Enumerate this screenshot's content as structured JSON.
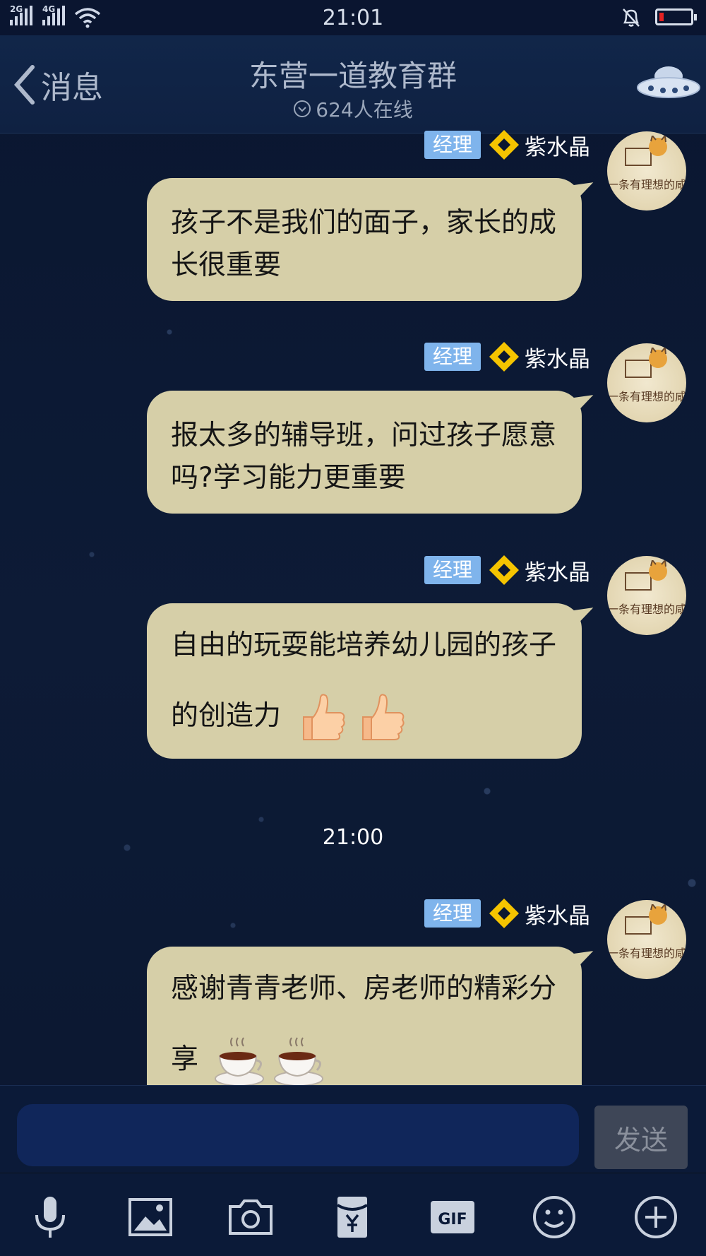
{
  "status_bar": {
    "signal1_label": "2G",
    "signal2_label": "4G",
    "time": "21:01"
  },
  "header": {
    "back_label": "消息",
    "title": "东营一道教育群",
    "online_count": "624人在线"
  },
  "messages": [
    {
      "role": "经理",
      "nickname": "紫水晶",
      "text": "孩子不是我们的面子，家长的成长很重要",
      "emoji": []
    },
    {
      "role": "经理",
      "nickname": "紫水晶",
      "text": "报太多的辅导班，问过孩子愿意吗?学习能力更重要",
      "emoji": []
    },
    {
      "role": "经理",
      "nickname": "紫水晶",
      "text": "自由的玩耍能培养幼儿园的孩子的创造力",
      "emoji": [
        "thumbs-up",
        "thumbs-up"
      ]
    },
    {
      "role": "经理",
      "nickname": "紫水晶",
      "text": "感谢青青老师、房老师的精彩分享",
      "emoji": [
        "coffee-cup",
        "coffee-cup"
      ]
    }
  ],
  "avatar_text": "一条有理想的咸",
  "timestamp": "21:00",
  "input": {
    "value": "",
    "send_label": "发送"
  },
  "toolbar": [
    "microphone-icon",
    "image-icon",
    "camera-icon",
    "red-packet-icon",
    "gif-icon",
    "emoji-icon",
    "plus-icon"
  ],
  "colors": {
    "background": "#0b1730",
    "bubble": "#d6cfa8",
    "role_badge": "#7fb4ec",
    "diamond": "#f5c400"
  }
}
